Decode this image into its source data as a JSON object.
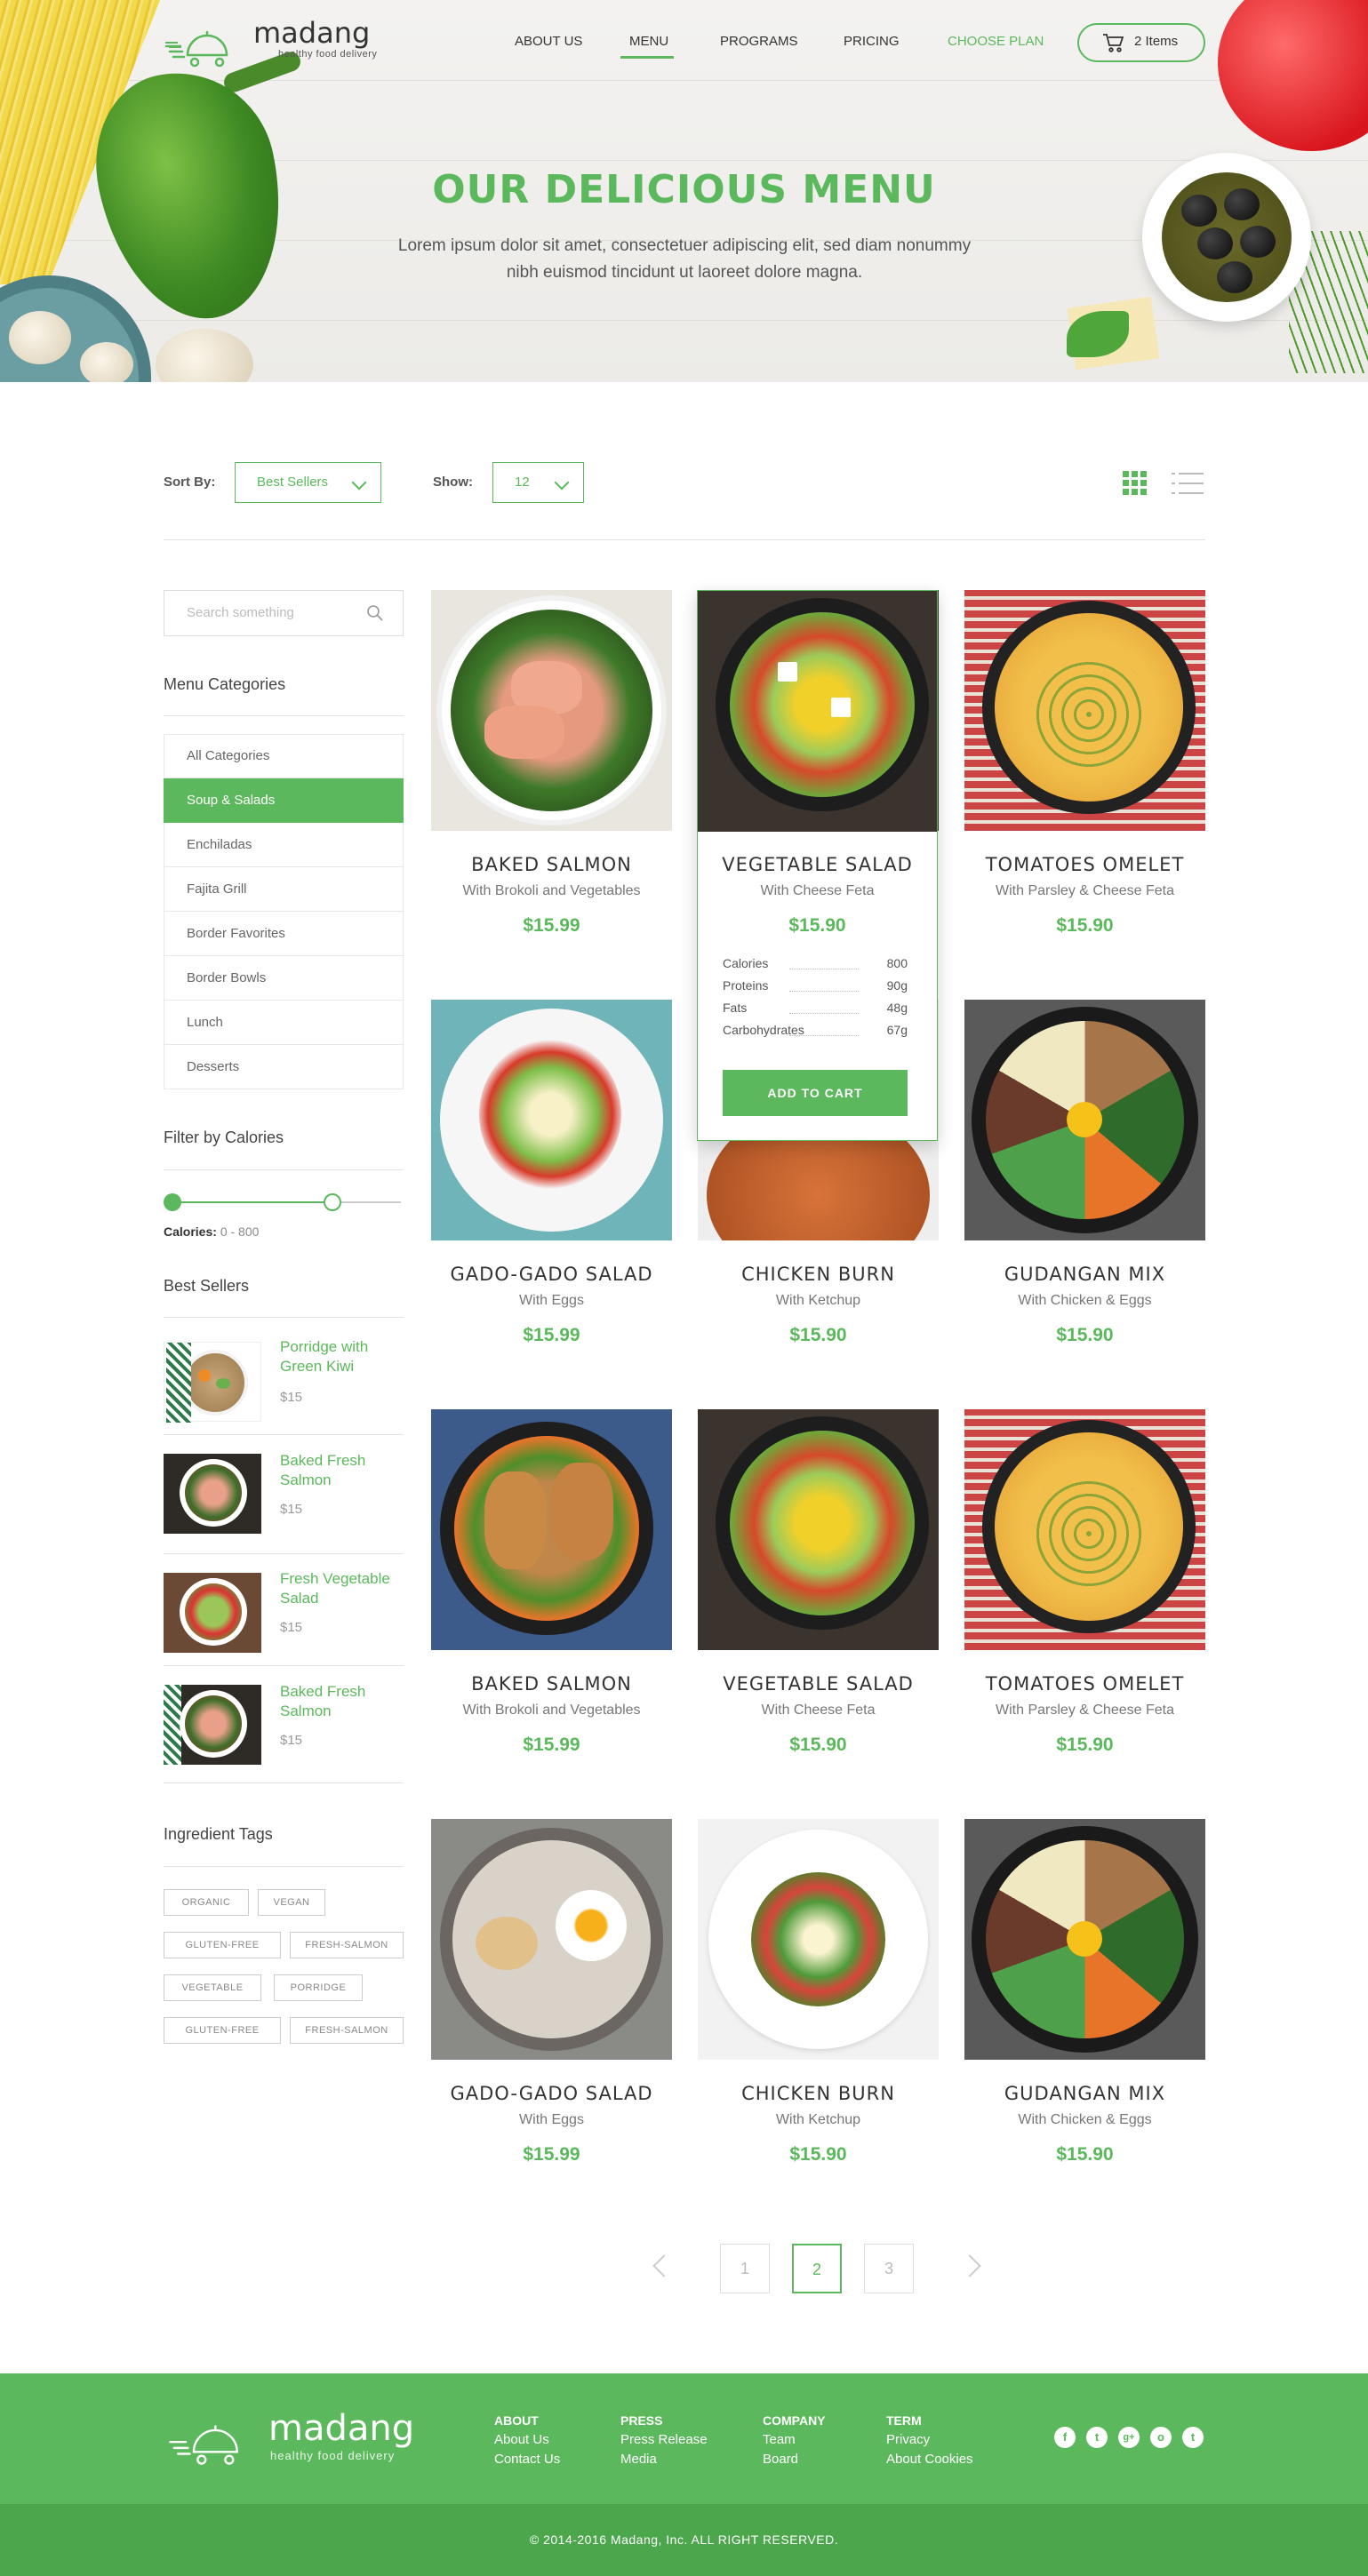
{
  "brand": {
    "name": "madang",
    "tagline": "healthy food delivery"
  },
  "nav": {
    "items": [
      "ABOUT US",
      "MENU",
      "PROGRAMS",
      "PRICING",
      "CHOOSE PLAN"
    ],
    "cart_label": "2 Items"
  },
  "hero": {
    "title": "OUR DELICIOUS MENU",
    "subtitle_line1": "Lorem ipsum dolor sit amet, consectetuer adipiscing elit, sed diam nonummy",
    "subtitle_line2": "nibh euismod tincidunt ut laoreet dolore magna."
  },
  "toolbar": {
    "sort_label": "Sort By:",
    "sort_value": "Best Sellers",
    "show_label": "Show:",
    "show_value": "12"
  },
  "sidebar": {
    "search_placeholder": "Search something",
    "categories_title": "Menu Categories",
    "categories": [
      "All Categories",
      "Soup & Salads",
      "Enchiladas",
      "Fajita Grill",
      "Border Favorites",
      "Border Bowls",
      "Lunch",
      "Desserts"
    ],
    "active_category": "Soup & Salads",
    "calories_title": "Filter by Calories",
    "calories_label": "Calories:",
    "calories_range": "0 - 800",
    "calories_slider_fraction": 0.7,
    "bestsellers_title": "Best Sellers",
    "bestsellers": [
      {
        "name": "Porridge with Green Kiwi",
        "price": "$15"
      },
      {
        "name": "Baked Fresh Salmon",
        "price": "$15"
      },
      {
        "name": "Fresh Vegetable Salad",
        "price": "$15"
      },
      {
        "name": "Baked Fresh Salmon",
        "price": "$15"
      }
    ],
    "tags_title": "Ingredient Tags",
    "tags": [
      "ORGANIC",
      "VEGAN",
      "GLUTEN-FREE",
      "FRESH-SALMON",
      "VEGETABLE",
      "PORRIDGE",
      "GLUTEN-FREE",
      "FRESH-SALMON"
    ]
  },
  "products": [
    {
      "name": "BAKED SALMON",
      "desc": "With Brokoli and Vegetables",
      "price": "$15.99"
    },
    {
      "name": "VEGETABLE SALAD",
      "desc": "With Cheese Feta",
      "price": "$15.90"
    },
    {
      "name": "TOMATOES OMELET",
      "desc": "With Parsley & Cheese Feta",
      "price": "$15.90"
    },
    {
      "name": "GADO-GADO SALAD",
      "desc": "With Eggs",
      "price": "$15.99"
    },
    {
      "name": "CHICKEN BURN",
      "desc": "With Ketchup",
      "price": "$15.90"
    },
    {
      "name": "GUDANGAN MIX",
      "desc": "With Chicken & Eggs",
      "price": "$15.90"
    },
    {
      "name": "BAKED SALMON",
      "desc": "With Brokoli and Vegetables",
      "price": "$15.99"
    },
    {
      "name": "VEGETABLE SALAD",
      "desc": "With Cheese Feta",
      "price": "$15.90"
    },
    {
      "name": "TOMATOES OMELET",
      "desc": "With Parsley & Cheese Feta",
      "price": "$15.90"
    },
    {
      "name": "GADO-GADO SALAD",
      "desc": "With Eggs",
      "price": "$15.99"
    },
    {
      "name": "CHICKEN BURN",
      "desc": "With Ketchup",
      "price": "$15.90"
    },
    {
      "name": "GUDANGAN MIX",
      "desc": "With Chicken & Eggs",
      "price": "$15.90"
    }
  ],
  "nutrition": [
    {
      "label": "Calories",
      "value": "800"
    },
    {
      "label": "Proteins",
      "value": "90g"
    },
    {
      "label": "Fats",
      "value": "48g"
    },
    {
      "label": "Carbohydrates",
      "value": "67g"
    }
  ],
  "add_to_cart": "ADD TO CART",
  "pagination": {
    "pages": [
      "1",
      "2",
      "3"
    ],
    "current": "2"
  },
  "footer": {
    "cols": [
      {
        "title": "ABOUT",
        "links": [
          "About Us",
          "Contact Us"
        ]
      },
      {
        "title": "PRESS",
        "links": [
          "Press Release",
          "Media"
        ]
      },
      {
        "title": "COMPANY",
        "links": [
          "Team",
          "Board"
        ]
      },
      {
        "title": "TERM",
        "links": [
          "Privacy",
          "About Cookies"
        ]
      }
    ],
    "social": [
      "f",
      "t",
      "g+",
      "o",
      "t"
    ],
    "copyright": "© 2014-2016 Madang, Inc. ALL RIGHT RESERVED."
  },
  "colors": {
    "accent": "#5cb85c",
    "footer": "#5cb85c",
    "footer_bottom": "#4ca64c"
  },
  "icons": [
    "menu-lines-icon",
    "cart-icon",
    "chevron-down-icon",
    "grid-view-icon",
    "list-view-icon",
    "search-icon",
    "prev-arrow-icon",
    "next-arrow-icon",
    "facebook-icon",
    "twitter-icon",
    "googleplus-icon",
    "instagram-icon",
    "tumblr-icon"
  ]
}
